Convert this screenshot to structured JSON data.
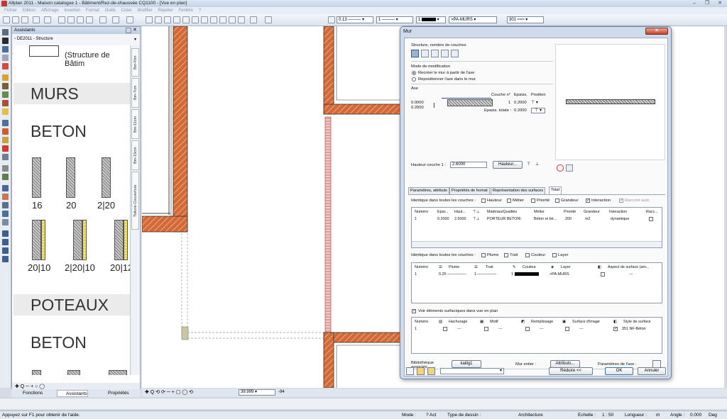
{
  "window": {
    "title": "Allplan 2011 - Maison catalogue 1 - Bâtiment/Rez-de-chaussée CQ1100 - [Vue en plan]",
    "controls": [
      "–",
      "❐",
      "✕"
    ]
  },
  "menu": [
    "Fichier",
    "Edition",
    "Affichage",
    "Insertion",
    "Format",
    "Outils",
    "Créer",
    "Modifier",
    "Répéter",
    "Fenêtre",
    "?"
  ],
  "toolbar": {
    "pen": "0.13",
    "line": "1",
    "color": "1",
    "layer": ">PA-MURS",
    "pattern": "301"
  },
  "assistants": {
    "title": "Assistants",
    "tree_item": "DE2011 - Structure",
    "catalog_header": "(Structure de Bâtim",
    "sections": {
      "murs": "MURS",
      "beton": "BETON",
      "poteaux": "POTEAUX",
      "beton2": "BETON"
    },
    "wall_labels_row1": [
      "16",
      "20",
      "2|20"
    ],
    "wall_labels_row2": [
      "20|10",
      "2|20|10",
      "20|12"
    ],
    "vtabs": [
      "Bm-Kim",
      "Bm-7cm",
      "Bm-11cm",
      "Bm-15cm",
      "Toiture-Couverture"
    ],
    "bottom_tabs": [
      "Fonctions",
      "Assistants",
      "Propriétés"
    ]
  },
  "canvas_foot": {
    "zoom": "39.999",
    "value2": "-94"
  },
  "status": {
    "help": "Appuyez sur F1 pour obtenir de l'aide.",
    "mode_label": "Mode :",
    "mode_value": "? Act",
    "type_label": "Type de dessin :",
    "type_value": "Architecture",
    "scale_label": "Echelle :",
    "scale_value": "1 : 50",
    "length_label": "Longueur :",
    "length_value": "m",
    "angle_label": "Angle :",
    "angle_value": "0.000",
    "angle_unit": "Deg"
  },
  "dialog": {
    "title": "Mur",
    "close": "✕",
    "structure_label": "Structure, nombre de couches",
    "mode_label": "Mode de modification",
    "mode_options": [
      "Recréer le mur à partir de l'axe",
      "Repositionner l'axe dans le mur"
    ],
    "axe_label": "Axe",
    "axe_values": [
      "0.0000",
      "0.2000"
    ],
    "couche_label": "Couche n°",
    "epais_label": "Epaiss.",
    "position_label": "Position",
    "couche_value": "1",
    "epais_value": "0.2000",
    "total_label": "Epaiss. totale :",
    "total_value": "0.2000",
    "hauteur_label": "Hauteur couche 1 :",
    "hauteur_value": "2.6000",
    "hauteur_btn": "Hauteur...",
    "tabs": [
      "Paramètres, attributs",
      "Propriétés de format",
      "Représentation des surfaces",
      "Total"
    ],
    "identique1": "Identique dans toutes les couches :",
    "identique1_opts": [
      {
        "label": "Hauteur",
        "checked": false
      },
      {
        "label": "Métier",
        "checked": false
      },
      {
        "label": "Priorité",
        "checked": false
      },
      {
        "label": "Grandeur",
        "checked": false
      },
      {
        "label": "Interaction",
        "checked": true
      },
      {
        "label": "Raccord auto",
        "checked": true
      }
    ],
    "table1_headers": [
      "Numéro",
      "Epai...",
      "Haut...",
      "",
      "Matériau/Qualités",
      "Métier",
      "Priorité",
      "Grandeur",
      "Interaction",
      "Racc..."
    ],
    "table1_row": [
      "1",
      "0.2000",
      "2.6000",
      "",
      "PORTEUR BETON\\",
      "Béton et bé...",
      "200",
      "m2",
      "dynamique",
      ""
    ],
    "identique2": "Identique dans toutes les couches :",
    "identique2_opts": [
      "Plume",
      "Trait",
      "Couleur",
      "Layer"
    ],
    "table2_headers": [
      "Numéro",
      "Plume",
      "Trait",
      "Couleur",
      "Layer",
      "Aspect de surface (ani..."
    ],
    "table2_row": [
      "1",
      "0.25",
      "1",
      "1",
      ">PA-MURS",
      "",
      "---"
    ],
    "voir_label": "Voir éléments surfaciques dans vue en plan",
    "table3_headers": [
      "Numéro",
      "Hachurage",
      "Motif",
      "Remplissage",
      "Surface d'image",
      "Style de surface"
    ],
    "table3_row": [
      "1",
      "---",
      "---",
      "---",
      "---",
      "351 NF-Béton"
    ],
    "biblio_label": "Bibliothèque\nassociée",
    "biblio_btn": "kaillg1",
    "mur_entier": "Mur entier :",
    "attributs_btn": "Attributs...",
    "params_axe": "Paramètres de l'axe :",
    "reduire_btn": "Réduire <<",
    "ok_btn": "OK",
    "annuler_btn": "Annuler"
  }
}
